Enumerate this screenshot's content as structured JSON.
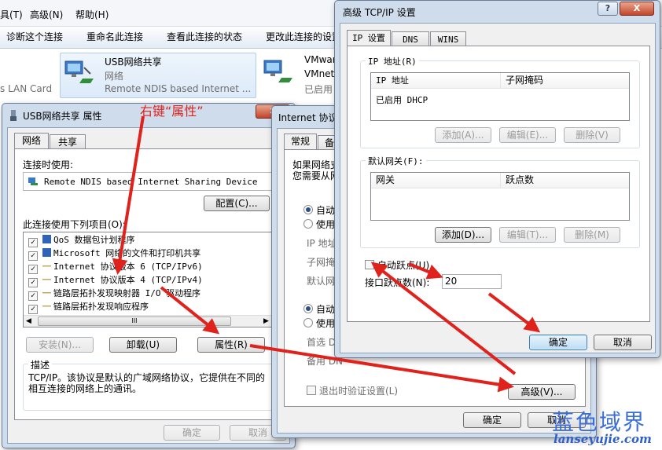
{
  "explorer": {
    "menu": [
      "具(T)",
      "高级(N)",
      "帮助(H)"
    ],
    "commands": [
      "诊断这个连接",
      "重命名此连接",
      "查看此连接的状态",
      "更改此连接的设置"
    ],
    "left_adapter_tail": "s LAN Card",
    "adapter1": {
      "name": "USB网络共享",
      "status": "网络",
      "device": "Remote NDIS based Internet ..."
    },
    "adapter2": {
      "name": "VMwar",
      "status": "VMnet",
      "state": "已启用"
    }
  },
  "props": {
    "title": "USB网络共享 属性",
    "tabs": [
      "网络",
      "共享"
    ],
    "connect_using_label": "连接时使用:",
    "device": "Remote NDIS based Internet Sharing Device",
    "configure": "配置(C)...",
    "items_label": "此连接使用下列项目(O):",
    "items": [
      {
        "text": "QoS 数据包计划程序",
        "checked": true,
        "icon": "qos-icon"
      },
      {
        "text": "Microsoft 网络的文件和打印机共享",
        "checked": true,
        "icon": "share-icon"
      },
      {
        "text": "Internet 协议版本 6 (TCP/IPv6)",
        "checked": true,
        "icon": "protocol-icon"
      },
      {
        "text": "Internet 协议版本 4 (TCP/IPv4)",
        "checked": true,
        "icon": "protocol-icon"
      },
      {
        "text": "链路层拓扑发现映射器 I/O 驱动程序",
        "checked": true,
        "icon": "protocol-icon"
      },
      {
        "text": "链路层拓扑发现响应程序",
        "checked": true,
        "icon": "protocol-icon"
      }
    ],
    "scroll_mid": "III",
    "install": "安装(N)...",
    "uninstall": "卸载(U)",
    "properties": "属性(R)",
    "desc_label": "描述",
    "desc_text": "TCP/IP。该协议是默认的广域网络协议，它提供在不同的相互连接的网络上的通讯。",
    "ok": "确定",
    "cancel": "取消"
  },
  "ipv4": {
    "title_partial": "Internet 协议",
    "tabs": [
      "常规",
      "备"
    ],
    "line1": "如果网络支",
    "line2": "您需要从网",
    "auto1": "自动获",
    "use1": "使用",
    "ip_label": "IP 地址",
    "mask_label": "子网掩码",
    "gw_label": "默认网关",
    "auto2": "自动获",
    "use2": "使用",
    "pref_label": "首选 DN",
    "alt_label": "备用 DN",
    "validate": "退出时验证设置(L)",
    "advanced": "高级(V)...",
    "ok": "确定",
    "cancel": "取消"
  },
  "adv": {
    "title": "高级 TCP/IP 设置",
    "help": "?",
    "close": "X",
    "tabs": [
      "IP 设置",
      "DNS",
      "WINS"
    ],
    "ip_group": "IP 地址(R)",
    "ip_col": "IP 地址",
    "mask_col": "子网掩码",
    "dhcp": "已启用 DHCP",
    "add": "添加(A)...",
    "edit": "编辑(E)...",
    "remove": "删除(V)",
    "gw_group": "默认网关(F):",
    "gw_col": "网关",
    "metric_col": "跃点数",
    "add2": "添加(D)...",
    "edit2": "编辑(T)...",
    "remove2": "删除(M)",
    "auto_metric": "自动跃点(U)",
    "metric_label": "接口跃点数(N):",
    "metric_value": "20",
    "ok": "确定",
    "cancel": "取消"
  },
  "annotation": {
    "text": "右键“属性”",
    "color": "#e0221c"
  },
  "watermark": {
    "cn": "蓝色域界",
    "en": "lanseyujie.com"
  }
}
